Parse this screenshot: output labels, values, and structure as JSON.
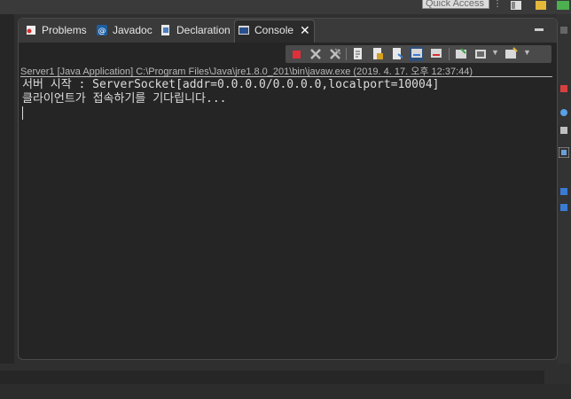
{
  "quick_access": {
    "label": "Quick Access"
  },
  "tabs": [
    {
      "label": "Problems",
      "icon": "problems-icon"
    },
    {
      "label": "Javadoc",
      "icon": "javadoc-icon"
    },
    {
      "label": "Declaration",
      "icon": "declaration-icon"
    },
    {
      "label": "Console",
      "icon": "console-icon",
      "active": true
    }
  ],
  "console": {
    "header": "Server1 [Java Application] C:\\Program Files\\Java\\jre1.8.0_201\\bin\\javaw.exe (2019. 4. 17. 오후 12:37:44)",
    "lines": [
      "서버 시작 : ServerSocket[addr=0.0.0.0/0.0.0.0,localport=10004]",
      "클라이언트가 접속하기를 기다립니다..."
    ]
  },
  "colors": {
    "terminate": "#e0303a",
    "background": "#2f2f2f",
    "console_bg": "#252525"
  }
}
